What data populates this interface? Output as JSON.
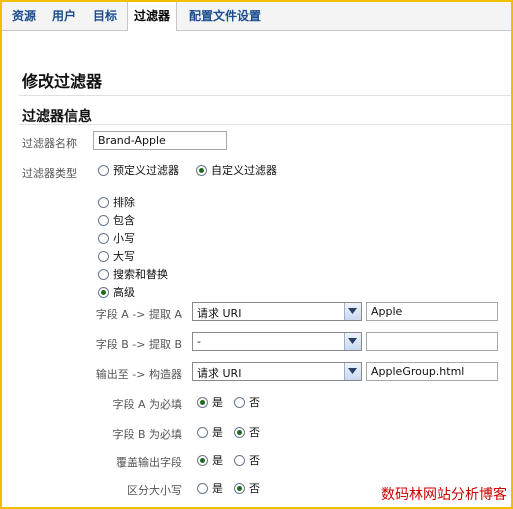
{
  "tabs": [
    {
      "label": "资源"
    },
    {
      "label": "用户"
    },
    {
      "label": "目标"
    },
    {
      "label": "过滤器"
    },
    {
      "label": "配置文件设置"
    }
  ],
  "page_title": "修改过滤器",
  "section_title": "过滤器信息",
  "filter_name": {
    "label": "过滤器名称",
    "value": "Brand-Apple"
  },
  "filter_type": {
    "label": "过滤器类型",
    "options": [
      {
        "label": "预定义过滤器",
        "checked": false
      },
      {
        "label": "自定义过滤器",
        "checked": true
      }
    ]
  },
  "custom_types": [
    {
      "label": "排除",
      "checked": false
    },
    {
      "label": "包含",
      "checked": false
    },
    {
      "label": "小写",
      "checked": false
    },
    {
      "label": "大写",
      "checked": false
    },
    {
      "label": "搜索和替换",
      "checked": false
    },
    {
      "label": "高级",
      "checked": true
    }
  ],
  "field_rows": [
    {
      "label": "字段 A -> 提取 A",
      "select": "请求 URI",
      "input": "Apple"
    },
    {
      "label": "字段 B -> 提取 B",
      "select": "-",
      "input": ""
    },
    {
      "label": "输出至 -> 构造器",
      "select": "请求 URI",
      "input": "AppleGroup.html"
    }
  ],
  "options_rows": [
    {
      "label": "字段 A 为必填",
      "yes": "是",
      "no": "否",
      "selected": "yes"
    },
    {
      "label": "字段 B 为必填",
      "yes": "是",
      "no": "否",
      "selected": "no"
    },
    {
      "label": "覆盖输出字段",
      "yes": "是",
      "no": "否",
      "selected": "yes"
    },
    {
      "label": "区分大小写",
      "yes": "是",
      "no": "否",
      "selected": "no"
    }
  ],
  "watermark": "数码林网站分析博客",
  "colors": {
    "border": "#f0c000",
    "link": "#1a4d8f",
    "watermark": "#cc0000"
  }
}
